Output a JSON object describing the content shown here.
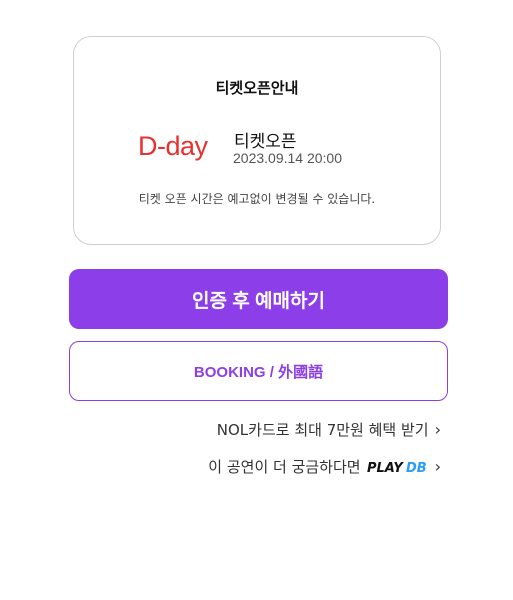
{
  "ticket_open_card": {
    "title": "티켓오픈안내",
    "dday": "D-day",
    "open_label": "티켓오픈",
    "open_datetime": "2023.09.14 20:00",
    "notice": "티켓 오픈 시간은 예고없이 변경될 수 있습니다."
  },
  "buttons": {
    "reserve_label": "인증 후 예매하기",
    "booking_label": "BOOKING / 外國語"
  },
  "links": {
    "nol_card": "NOL카드로 최대 7만원 혜택 받기",
    "performance_curious": "이 공연이 더 궁금하다면",
    "playdb_logo_text": "PLAYDB",
    "chevron_icon": "chevron-right-icon"
  },
  "colors": {
    "accent": "#8c3fe8",
    "dday": "#e8312f",
    "playdb_blue": "#2a9df4"
  }
}
